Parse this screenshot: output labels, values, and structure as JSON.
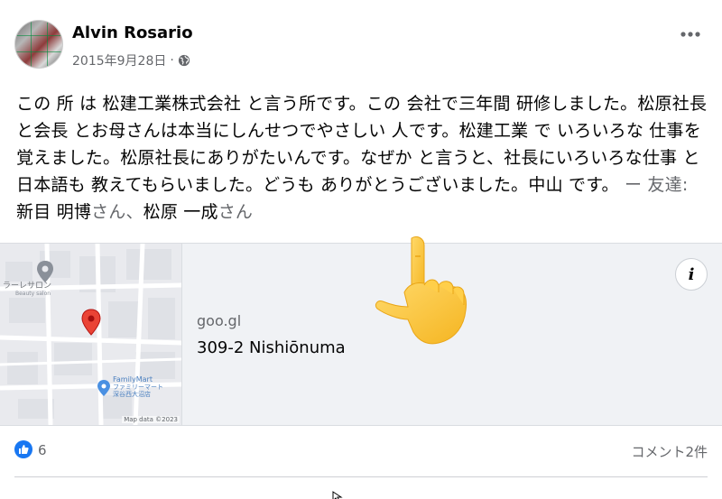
{
  "post": {
    "author": "Alvin Rosario",
    "date": "2015年9月28日",
    "separator": "·",
    "text_main": "この 所 は 松建工業株式会社 と言う所です。この 会社で三年間 研修しました。松原社長 と会長 とお母さんは本当にしんせつでやさしい 人です。松建工業 で いろいろな 仕事を覚えました。松原社長にありがたいんです。なぜか と言うと、社長にいろいろな仕事 と日本語も 教えてもらいました。どうも ありがとうございました。中山 です。",
    "tag_prefix": " ー 友達: ",
    "tag_name1": "新目 明博",
    "tag_suffix1": "さん",
    "tag_sep": "、",
    "tag_name2": "松原 一成",
    "tag_suffix2": "さん"
  },
  "link_card": {
    "domain": "goo.gl",
    "place": "309-2 Nishiōnuma",
    "info_label": "i",
    "map": {
      "poi1": "ラーレサロン",
      "poi1_sub": "Beauty salon",
      "poi2": "FamilyMart",
      "poi2_jp": "ファミリーマート",
      "poi2_sub": "深谷西大沼店",
      "attribution": "Map data ©2023"
    }
  },
  "footer": {
    "like_count": "6",
    "comment_count": "コメント2件"
  },
  "colors": {
    "like_blue": "#1877f2",
    "map_pin": "#ea4335",
    "secondary_text": "#65676b"
  },
  "icons": {
    "avatar": "avatar",
    "globe": "globe-icon",
    "more": "more-options-icon",
    "info": "info-icon",
    "like": "thumbs-up-icon",
    "hand": "pointing-up-hand-emoji"
  }
}
